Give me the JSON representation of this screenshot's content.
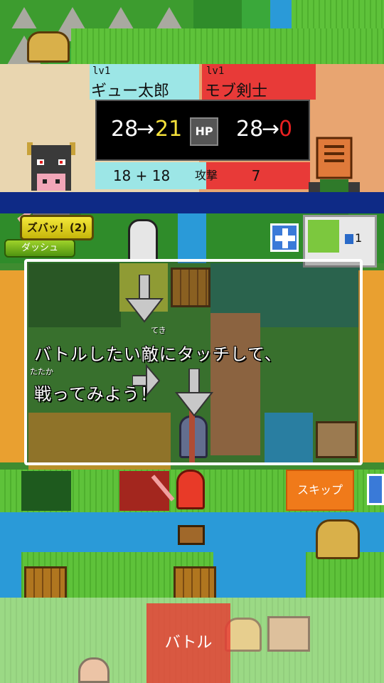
{
  "ally": {
    "level": "lv1",
    "name": "ギュー太郎",
    "hp_before": "28",
    "hp_arrow": "→",
    "hp_after": "21",
    "attack": "18 + 18"
  },
  "enemy": {
    "level": "lv1",
    "name": "モブ剣士",
    "hp_before": "28",
    "hp_arrow": "→",
    "hp_after": "0",
    "attack": "7"
  },
  "hp_badge": "HP",
  "attack_label": "攻撃",
  "buttons": {
    "dash": "ダッシュ",
    "zubat": "ズバッ！(2)",
    "skip": "スキップ",
    "battle": "バトル"
  },
  "mini_indicator": {
    "count": "1"
  },
  "dialog": {
    "line1": "バトルしたい敵にタッチして、",
    "line2": "戦ってみよう！",
    "ruby_teki": "てき",
    "ruby_tatakai": "たたか"
  },
  "colors": {
    "ally_panel": "#9ce6e6",
    "enemy_panel": "#e83a38",
    "hp_after_ally": "#f4e03a",
    "hp_after_enemy": "#e82020",
    "navy": "#0e2a86"
  }
}
